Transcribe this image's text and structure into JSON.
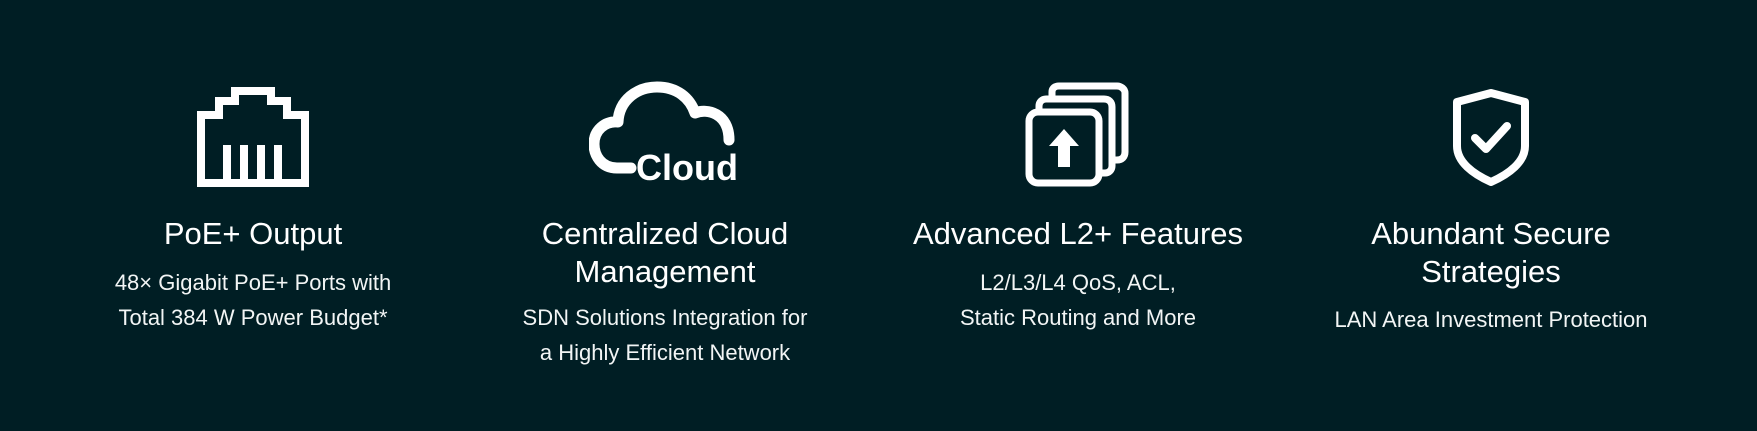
{
  "colors": {
    "background": "#001e24",
    "text": "#ffffff"
  },
  "features": [
    {
      "icon": "ethernet-port-icon",
      "title": "PoE+ Output",
      "description": "48× Gigabit PoE+ Ports with\nTotal 384 W Power Budget*"
    },
    {
      "icon": "cloud-icon",
      "icon_text": "Cloud",
      "title": "Centralized Cloud\nManagement",
      "description": "SDN Solutions Integration for\na Highly Efficient Network"
    },
    {
      "icon": "stacked-layers-upgrade-icon",
      "title": "Advanced L2+ Features",
      "description": "L2/L3/L4 QoS, ACL,\nStatic Routing and More"
    },
    {
      "icon": "shield-check-icon",
      "title": "Abundant Secure\nStrategies",
      "description": "LAN Area Investment Protection"
    }
  ]
}
